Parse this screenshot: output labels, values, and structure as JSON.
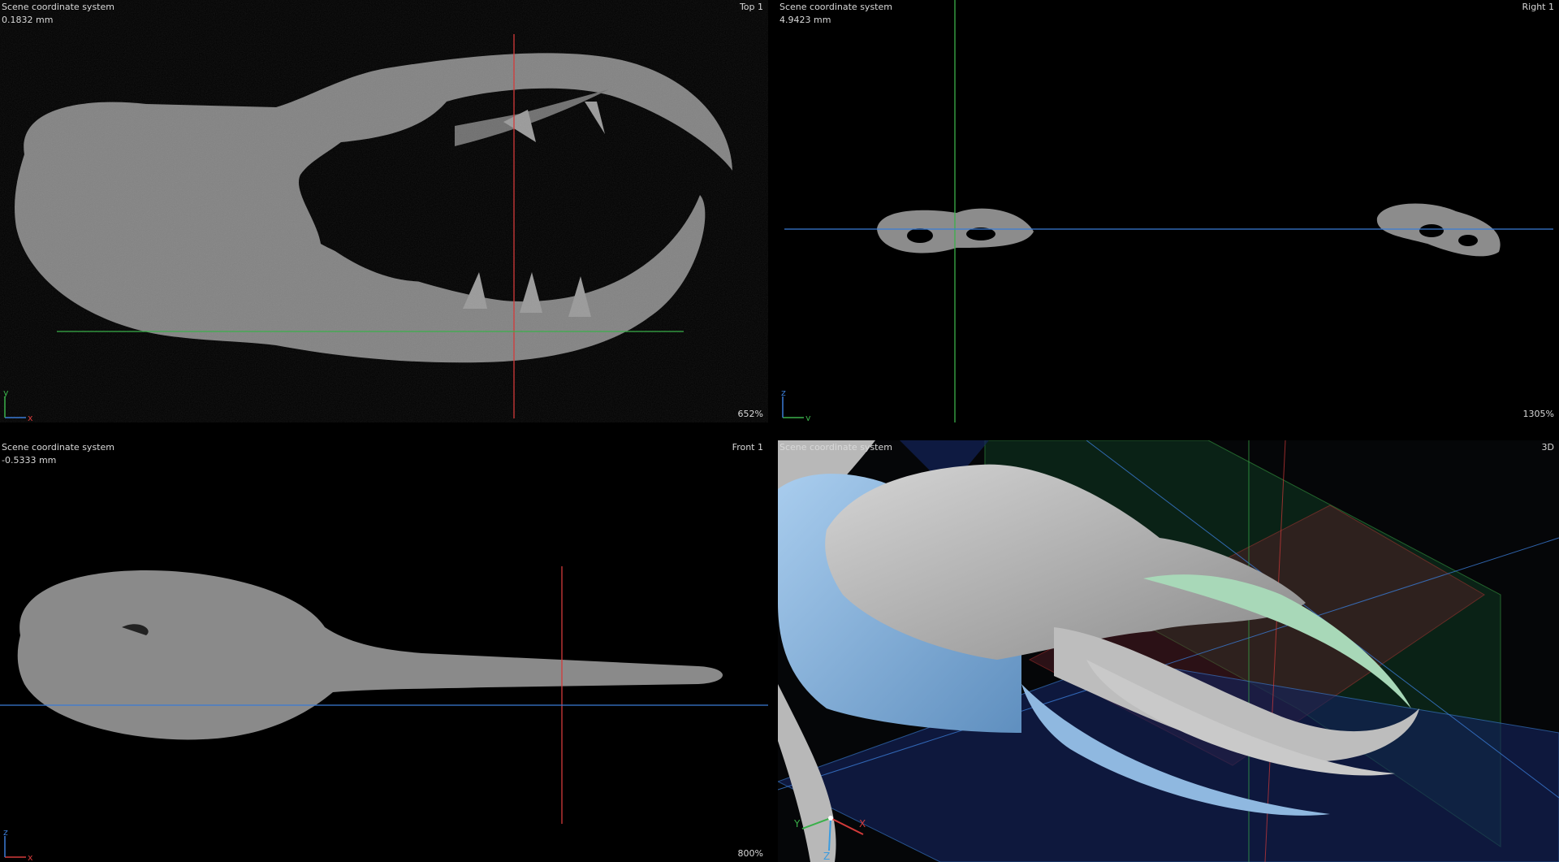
{
  "viewports": {
    "top": {
      "system_label": "Scene coordinate system",
      "position": "0.1832 mm",
      "view_name": "Top 1",
      "zoom": "652%",
      "axis_h": "x",
      "axis_v": "y"
    },
    "right": {
      "system_label": "Scene coordinate system",
      "position": "4.9423 mm",
      "view_name": "Right 1",
      "zoom": "1305%",
      "axis_h": "y",
      "axis_v": "z"
    },
    "front": {
      "system_label": "Scene coordinate system",
      "position": "-0.5333 mm",
      "view_name": "Front 1",
      "zoom": "800%",
      "axis_h": "x",
      "axis_v": "z"
    },
    "view3d": {
      "system_label": "Scene coordinate system",
      "view_name": "3D",
      "axis_x": "X",
      "axis_y": "Y",
      "axis_z": "Z"
    }
  },
  "colors": {
    "x_axis": "#d33a3a",
    "y_axis": "#3ab04a",
    "z_axis": "#3a7bd5",
    "slice_gray": "#8a8a8a",
    "mesh_gray": "#b9b9b9",
    "mesh_blue": "#8fb8e0",
    "mesh_green": "#9fcfae",
    "mesh_red": "#c99aa0"
  }
}
